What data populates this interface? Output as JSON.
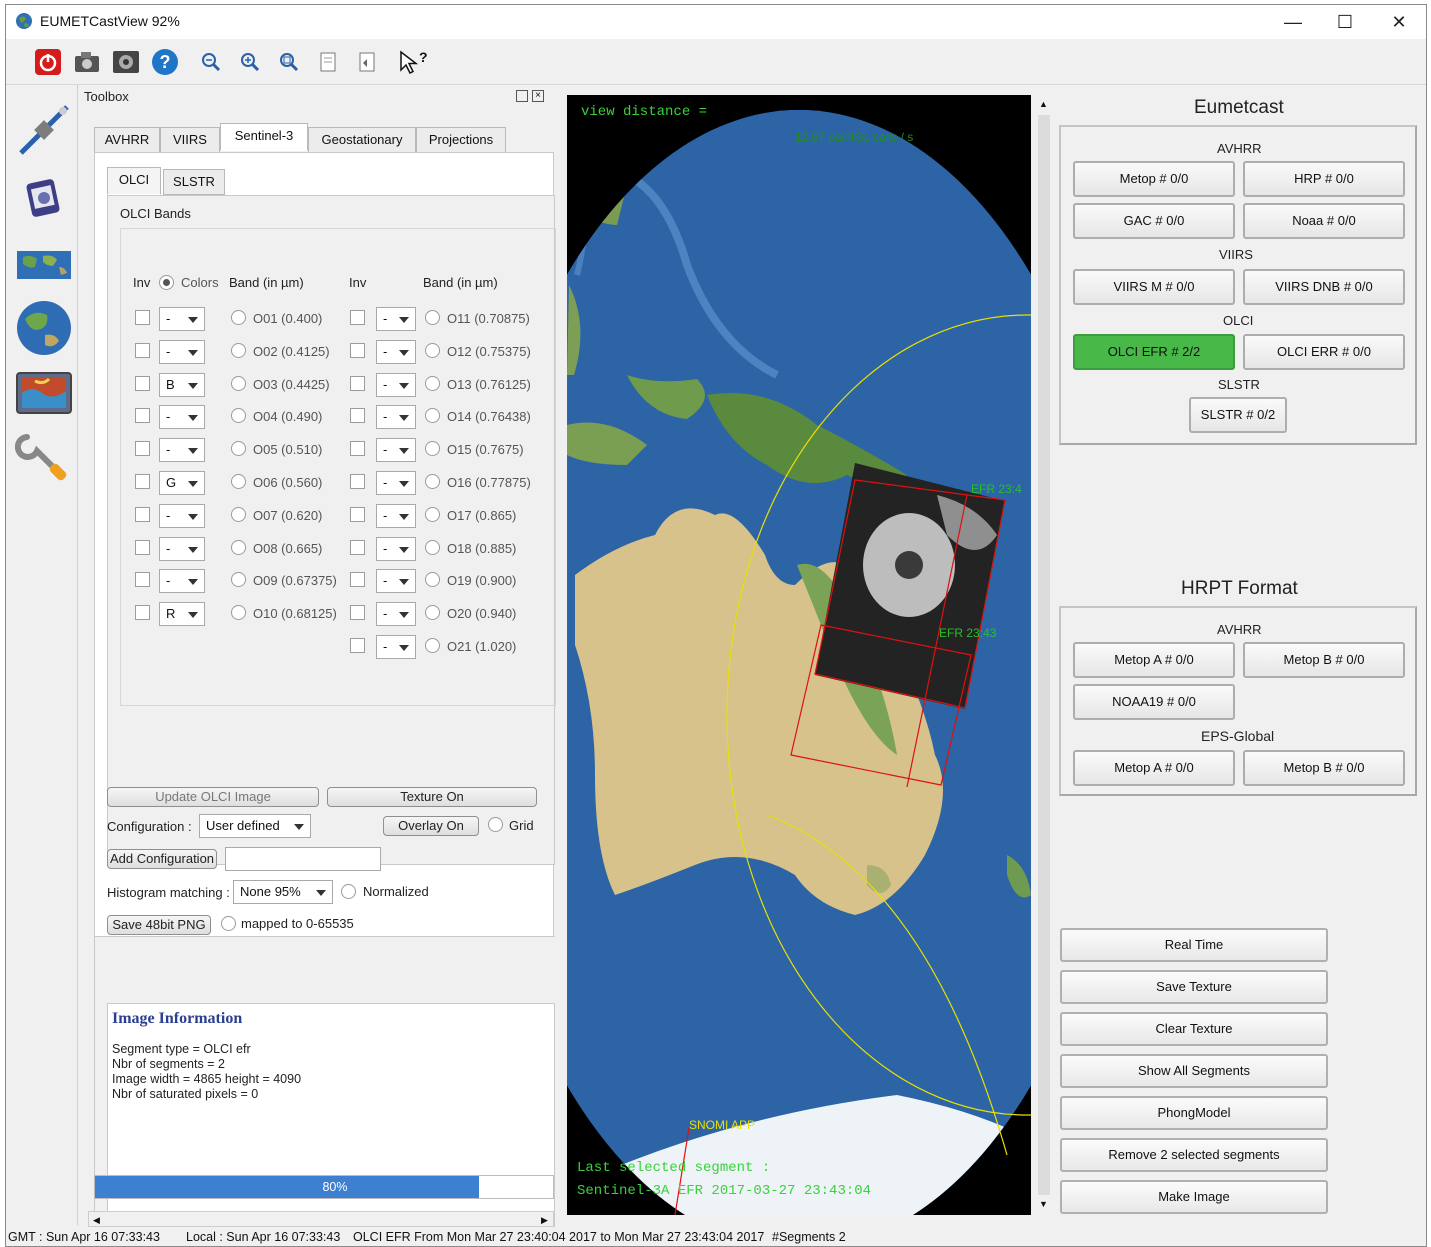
{
  "window": {
    "title": "EUMETCastView 92%",
    "controls": {
      "minimize": "—",
      "maximize": "☐",
      "close": "✕"
    }
  },
  "toolbar": {
    "icons": [
      "power-icon",
      "camera-icon",
      "film-icon",
      "help-icon",
      "zoom-out-icon",
      "zoom-in-icon",
      "zoom-fit-icon",
      "page-icon",
      "page-back-icon",
      "whats-this-icon"
    ]
  },
  "toolbox": {
    "title": "Toolbox",
    "tabs": [
      "AVHRR",
      "VIIRS",
      "Sentinel-3",
      "Geostationary",
      "Projections"
    ],
    "active_tab": "Sentinel-3",
    "subtabs": [
      "OLCI",
      "SLSTR"
    ],
    "bands_title": "OLCI Bands",
    "header": {
      "inv1": "Inv",
      "colors": "Colors",
      "band1": "Band (in µm)",
      "inv2": "Inv",
      "band2": "Band (in µm)"
    },
    "left_rows": [
      {
        "sel": "-",
        "band": "O01 (0.400)"
      },
      {
        "sel": "-",
        "band": "O02 (0.4125)"
      },
      {
        "sel": "B",
        "band": "O03 (0.4425)"
      },
      {
        "sel": "-",
        "band": "O04 (0.490)"
      },
      {
        "sel": "-",
        "band": "O05 (0.510)"
      },
      {
        "sel": "G",
        "band": "O06 (0.560)"
      },
      {
        "sel": "-",
        "band": "O07 (0.620)"
      },
      {
        "sel": "-",
        "band": "O08 (0.665)"
      },
      {
        "sel": "-",
        "band": "O09 (0.67375)"
      },
      {
        "sel": "R",
        "band": "O10 (0.68125)"
      }
    ],
    "right_rows": [
      {
        "sel": "-",
        "band": "O11 (0.70875)"
      },
      {
        "sel": "-",
        "band": "O12 (0.75375)"
      },
      {
        "sel": "-",
        "band": "O13 (0.76125)"
      },
      {
        "sel": "-",
        "band": "O14 (0.76438)"
      },
      {
        "sel": "-",
        "band": "O15 (0.7675)"
      },
      {
        "sel": "-",
        "band": "O16 (0.77875)"
      },
      {
        "sel": "-",
        "band": "O17 (0.865)"
      },
      {
        "sel": "-",
        "band": "O18 (0.885)"
      },
      {
        "sel": "-",
        "band": "O19 (0.900)"
      },
      {
        "sel": "-",
        "band": "O20 (0.940)"
      },
      {
        "sel": "-",
        "band": "O21 (1.020)"
      }
    ],
    "update_btn": "Update OLCI Image",
    "texture_btn": "Texture On",
    "config_label": "Configuration :",
    "config_value": "User defined",
    "overlay_btn": "Overlay On",
    "grid_label": "Grid",
    "add_config_btn": "Add Configuration",
    "hist_label": "Histogram matching :",
    "hist_value": "None 95%",
    "normalized_label": "Normalized",
    "save_png_btn": "Save 48bit PNG",
    "mapped_label": "mapped to 0-65535",
    "info": {
      "title": "Image Information",
      "lines": [
        "Segment type = OLCI efr",
        "Nbr of segments = 2",
        "Image width = 4865 height = 4090",
        "Nbr of saturated pixels = 0"
      ]
    },
    "progress": {
      "label": "80%",
      "value": 0.8
    }
  },
  "globe": {
    "view_distance": "view distance =",
    "paint_calls": "12.67 paintGL calls / s",
    "efr_label_1": "EFR 23:4",
    "efr_label_2": "EFR 23:43",
    "snomi_label": "SNOMI APP",
    "last_segment_1": "Last selected segment :",
    "last_segment_2": "Sentinel-3A EFR 2017-03-27 23:43:04"
  },
  "eumetcast": {
    "title": "Eumetcast",
    "avhrr_label": "AVHRR",
    "avhrr_buttons": [
      "Metop # 0/0",
      "HRP # 0/0",
      "GAC # 0/0",
      "Noaa # 0/0"
    ],
    "viirs_label": "VIIRS",
    "viirs_buttons": [
      "VIIRS M # 0/0",
      "VIIRS DNB # 0/0"
    ],
    "olci_label": "OLCI",
    "olci_buttons": [
      "OLCI EFR # 2/2",
      "OLCI ERR # 0/0"
    ],
    "slstr_label": "SLSTR",
    "slstr_button": "SLSTR # 0/2"
  },
  "hrpt": {
    "title": "HRPT Format",
    "avhrr_label": "AVHRR",
    "avhrr_buttons": [
      "Metop A # 0/0",
      "Metop B # 0/0",
      "NOAA19 # 0/0"
    ],
    "eps_label": "EPS-Global",
    "eps_buttons": [
      "Metop A # 0/0",
      "Metop B # 0/0"
    ]
  },
  "actions": [
    "Real Time",
    "Save Texture",
    "Clear Texture",
    "Show All Segments",
    "PhongModel",
    "Remove 2 selected segments",
    "Make Image"
  ],
  "status": {
    "gmt": "GMT : Sun Apr 16 07:33:43",
    "local": "Local : Sun Apr 16 07:33:43",
    "olci": "OLCI EFR From Mon Mar 27 23:40:04 2017 to Mon Mar 27 23:43:04 2017",
    "segments": "#Segments 2"
  },
  "colors": {
    "accent_green": "#48b848",
    "progress_blue": "#3d7fd0",
    "overlay_yellow": "#e8e000",
    "overlay_red": "#e01010",
    "info_title": "#2a3f8f"
  }
}
